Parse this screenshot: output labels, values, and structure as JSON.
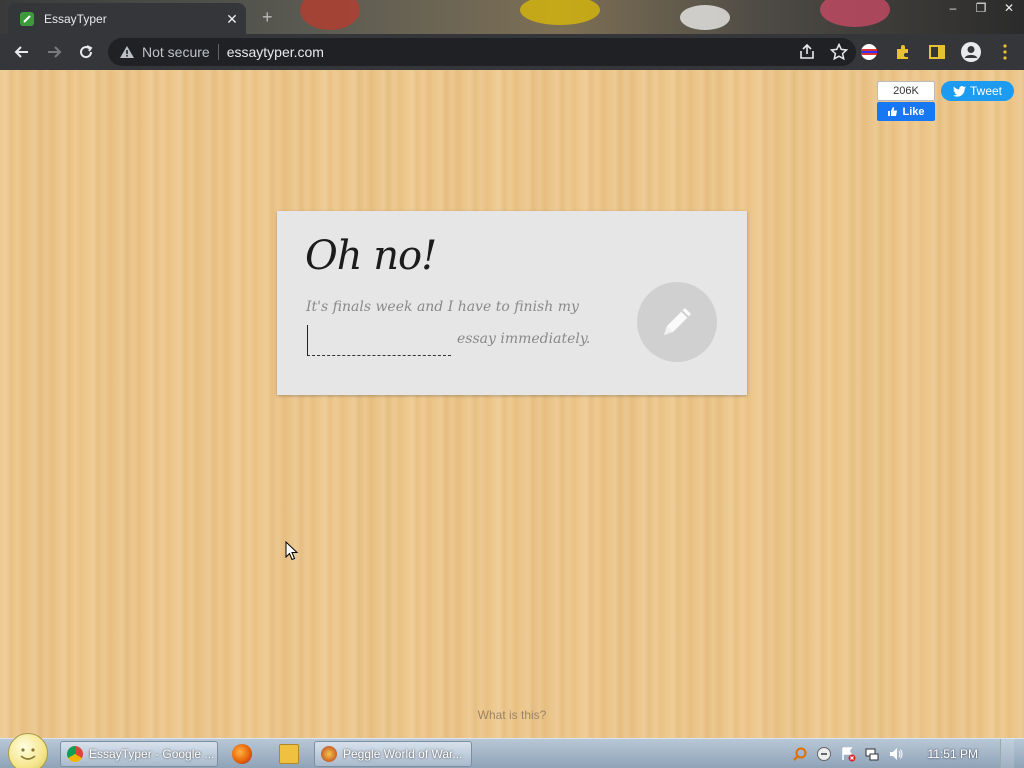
{
  "browser": {
    "tab_title": "EssayTyper",
    "security_label": "Not secure",
    "url": "essaytyper.com"
  },
  "social": {
    "fb_count": "206K",
    "fb_like_label": "Like",
    "tweet_label": "Tweet"
  },
  "card": {
    "heading": "Oh no!",
    "line1": "It's finals week and I have to finish my",
    "line2": "essay immediately.",
    "subject_value": ""
  },
  "footer": {
    "what_link": "What is this?"
  },
  "taskbar": {
    "tasks": [
      {
        "label": "EssayTyper - Google ..."
      },
      {
        "label": "Peggle World of War..."
      }
    ],
    "clock": "11:51 PM"
  },
  "colors": {
    "wood": "#eec98f",
    "card": "#e6e6e6",
    "facebook": "#1877f2",
    "twitter": "#1d9bf0"
  }
}
